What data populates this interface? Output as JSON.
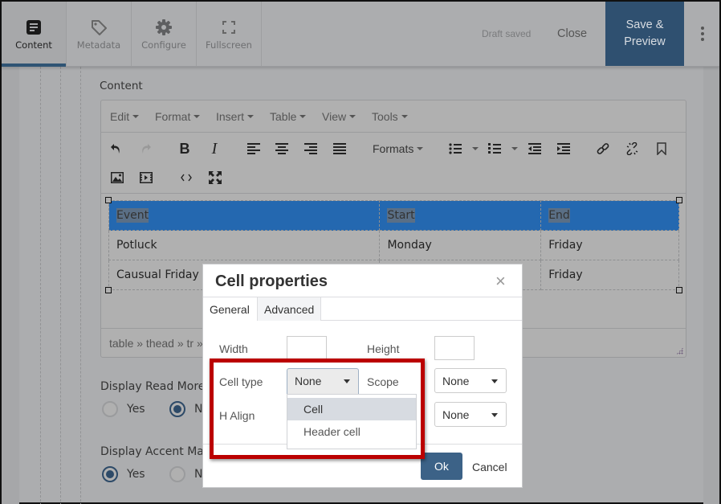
{
  "topbar": {
    "tabs": [
      {
        "label": "Content",
        "icon": "document-icon",
        "active": true
      },
      {
        "label": "Metadata",
        "icon": "tag-icon",
        "active": false
      },
      {
        "label": "Configure",
        "icon": "gear-icon",
        "active": false
      },
      {
        "label": "Fullscreen",
        "icon": "fullscreen-icon",
        "active": false
      }
    ],
    "status": "Draft saved",
    "close_label": "Close",
    "save_label_line1": "Save &",
    "save_label_line2": "Preview",
    "more_icon": "kebab-menu-icon",
    "accent_color": "#2f5070"
  },
  "content_section": {
    "label": "Content",
    "editor": {
      "menus": [
        "Edit",
        "Format",
        "Insert",
        "Table",
        "View",
        "Tools"
      ],
      "toolbar_row1": [
        "undo-icon",
        "redo-icon",
        "bold-icon",
        "italic-icon",
        "align-left-icon",
        "align-center-icon",
        "align-right-icon",
        "align-justify-icon",
        "Formats",
        "bullet-list-icon",
        "numbered-list-icon",
        "outdent-icon",
        "indent-icon",
        "link-icon",
        "unlink-icon",
        "bookmark-icon"
      ],
      "formats_label": "Formats",
      "toolbar_row2": [
        "image-icon",
        "media-icon",
        "source-code-icon",
        "fullscreen-icon"
      ],
      "table": {
        "header": [
          "Event",
          "Start",
          "End"
        ],
        "rows": [
          [
            "Potluck",
            "Monday",
            "Friday"
          ],
          [
            "Causual Friday",
            "",
            "Friday"
          ]
        ],
        "selection_color": "#2468b0"
      },
      "element_path": "table » thead » tr »"
    }
  },
  "display_read_more": {
    "label": "Display Read More",
    "options": [
      "Yes",
      "No"
    ],
    "selected": "No"
  },
  "display_accent_mark": {
    "label": "Display Accent Mark",
    "options": [
      "Yes",
      "No"
    ],
    "selected": "Yes"
  },
  "dialog": {
    "title": "Cell properties",
    "close_symbol": "×",
    "tabs": [
      "General",
      "Advanced"
    ],
    "active_tab": "General",
    "fields": {
      "width_label": "Width",
      "width_value": "",
      "height_label": "Height",
      "height_value": "",
      "cell_type_label": "Cell type",
      "cell_type_value": "None",
      "scope_label": "Scope",
      "scope_value": "None",
      "h_align_label": "H Align",
      "v_align_value": "None"
    },
    "cell_type_options": [
      "Cell",
      "Header cell"
    ],
    "highlighted_option": "Cell",
    "ok_label": "Ok",
    "cancel_label": "Cancel",
    "annotation_color": "#bb0000"
  }
}
